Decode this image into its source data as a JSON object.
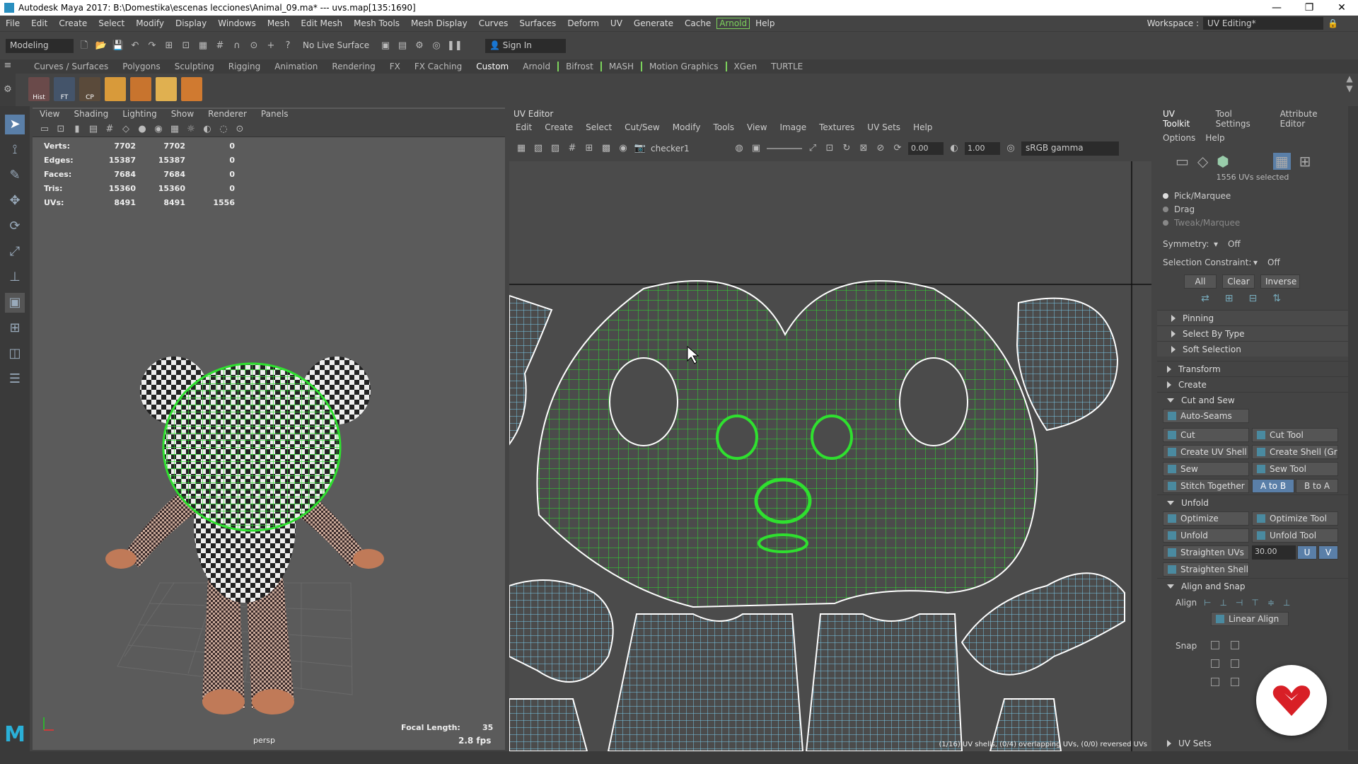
{
  "window": {
    "title": "Autodesk Maya 2017: B:\\Domestika\\escenas lecciones\\Animal_09.ma*   ---   uvs.map[135:1690]",
    "controls": [
      "—",
      "❐",
      "✕"
    ]
  },
  "menu_bar": {
    "items": [
      "File",
      "Edit",
      "Create",
      "Select",
      "Modify",
      "Display",
      "Windows",
      "Mesh",
      "Edit Mesh",
      "Mesh Tools",
      "Mesh Display",
      "Curves",
      "Surfaces",
      "Deform",
      "UV",
      "Generate",
      "Cache",
      "Arnold",
      "Help"
    ],
    "highlighted": "Arnold",
    "workspace_label": "Workspace :",
    "workspace_value": "UV Editing*"
  },
  "status_line": {
    "mode": "Modeling",
    "live_surface": "No Live Surface",
    "sign_in": "Sign In"
  },
  "shelf": {
    "tabs": [
      "Curves / Surfaces",
      "Polygons",
      "Sculpting",
      "Rigging",
      "Animation",
      "Rendering",
      "FX",
      "FX Caching",
      "Custom",
      "Arnold",
      "Bifrost",
      "MASH",
      "Motion Graphics",
      "XGen",
      "TURTLE"
    ],
    "active_tab": "Custom",
    "icons": [
      {
        "label": "Hist",
        "color": "#c44"
      },
      {
        "label": "FT",
        "color": "#3a6ea8"
      },
      {
        "label": "CP",
        "color": "#a8482e"
      },
      {
        "label": "",
        "color": "#d89a3a"
      },
      {
        "label": "",
        "color": "#c8742e"
      },
      {
        "label": "",
        "color": "#e0b050"
      },
      {
        "label": "",
        "color": "#d07a30"
      }
    ]
  },
  "viewport": {
    "menu": [
      "View",
      "Shading",
      "Lighting",
      "Show",
      "Renderer",
      "Panels"
    ],
    "hud": {
      "rows": [
        {
          "label": "Verts:",
          "a": "7702",
          "b": "7702",
          "c": "0"
        },
        {
          "label": "Edges:",
          "a": "15387",
          "b": "15387",
          "c": "0"
        },
        {
          "label": "Faces:",
          "a": "7684",
          "b": "7684",
          "c": "0"
        },
        {
          "label": "Tris:",
          "a": "15360",
          "b": "15360",
          "c": "0"
        },
        {
          "label": "UVs:",
          "a": "8491",
          "b": "8491",
          "c": "1556"
        }
      ]
    },
    "camera": "persp",
    "focal_label": "Focal Length:",
    "focal_value": "35",
    "fps": "2.8 fps"
  },
  "uv_editor": {
    "title": "UV Editor",
    "menu": [
      "Edit",
      "Create",
      "Select",
      "Cut/Sew",
      "Modify",
      "Tools",
      "View",
      "Image",
      "Textures",
      "UV Sets",
      "Help"
    ],
    "texture": "checker1",
    "exposure": "0.00",
    "gamma": "1.00",
    "color_space": "sRGB gamma",
    "status_text": "(1/16) UV shells, (0/4) overlapping UVs, (0/0) reversed UVs"
  },
  "toolkit": {
    "tabs": [
      "UV Toolkit",
      "Tool Settings",
      "Attribute Editor"
    ],
    "active_tab": "UV Toolkit",
    "submenu": [
      "Options",
      "Help"
    ],
    "selected_count": "1556 UVs selected",
    "modes": [
      "Pick/Marquee",
      "Drag",
      "Tweak/Marquee"
    ],
    "symmetry_label": "Symmetry:",
    "symmetry_value": "Off",
    "constraint_label": "Selection Constraint:",
    "constraint_value": "Off",
    "sel_buttons": [
      "All",
      "Clear",
      "Inverse"
    ],
    "collapsed_sections_1": [
      "Pinning",
      "Select By Type",
      "Soft Selection"
    ],
    "collapsed_sections_2": [
      "Transform",
      "Create"
    ],
    "cut_and_sew": {
      "title": "Cut and Sew",
      "auto_seams": "Auto-Seams",
      "cut": "Cut",
      "cut_tool": "Cut Tool",
      "create_uv_shell": "Create UV Shell",
      "create_shell_grid": "Create Shell (Grid)",
      "sew": "Sew",
      "sew_tool": "Sew Tool",
      "stitch_together": "Stitch Together",
      "a_to_b": "A to B",
      "b_to_a": "B to A"
    },
    "unfold": {
      "title": "Unfold",
      "optimize": "Optimize",
      "optimize_tool": "Optimize Tool",
      "unfold": "Unfold",
      "unfold_tool": "Unfold Tool",
      "straighten_uvs": "Straighten UVs",
      "straighten_value": "30.00",
      "u": "U",
      "v": "V",
      "straighten_shell": "Straighten Shell"
    },
    "align_snap": {
      "title": "Align and Snap",
      "align_label": "Align",
      "linear_align": "Linear Align",
      "snap_label": "Snap"
    },
    "uv_sets": "UV Sets"
  }
}
